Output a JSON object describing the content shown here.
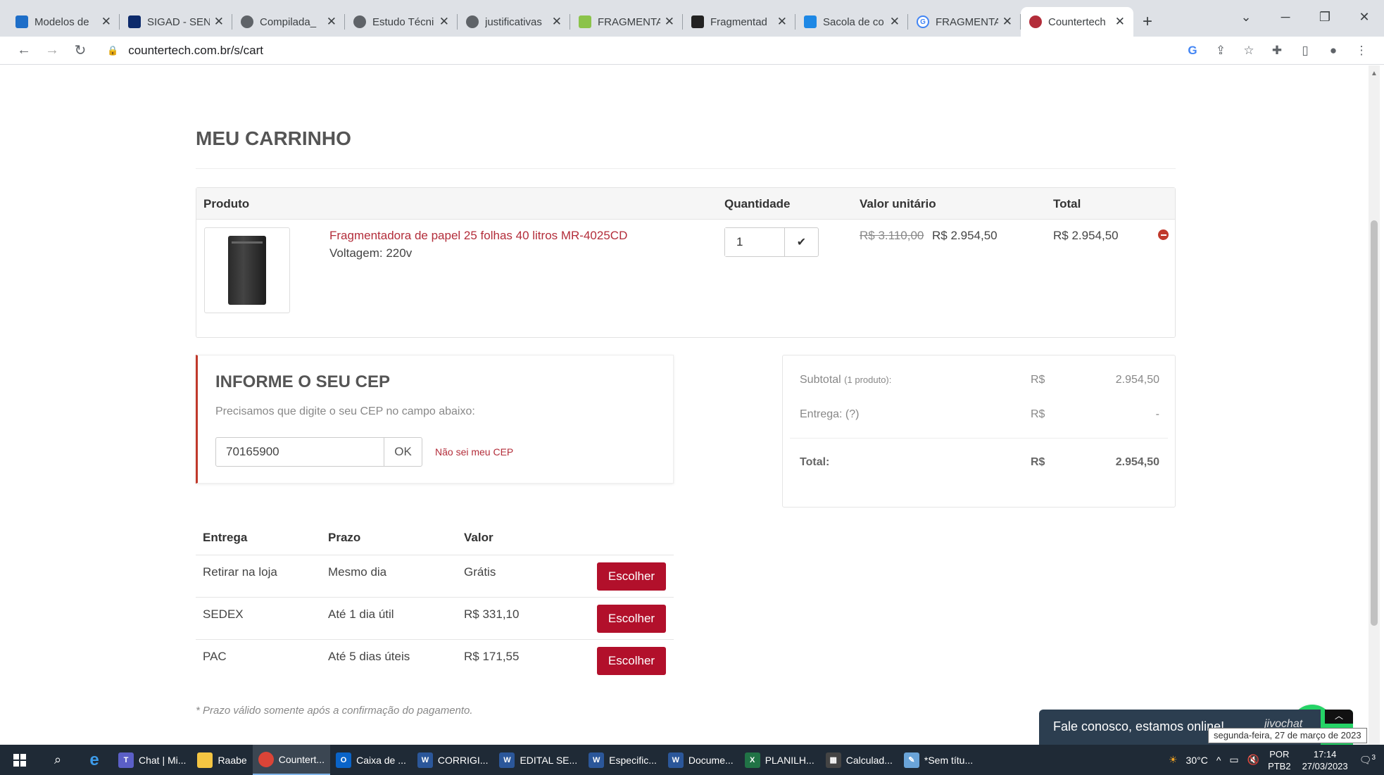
{
  "browser": {
    "tabs": [
      {
        "title": "Modelos de",
        "icon": "monitor-icon",
        "color": "#1e6ec8"
      },
      {
        "title": "SIGAD - SEN",
        "icon": "sigad-icon",
        "color": "#0d2a6b"
      },
      {
        "title": "Compilada_",
        "icon": "globe-icon",
        "color": "#5f6368"
      },
      {
        "title": "Estudo Técni",
        "icon": "globe-icon",
        "color": "#5f6368"
      },
      {
        "title": "justificativas",
        "icon": "globe-icon",
        "color": "#5f6368"
      },
      {
        "title": "FRAGMENTA",
        "icon": "green-doc-icon",
        "color": "#8bc34a"
      },
      {
        "title": "Fragmentad",
        "icon": "dark-square-icon",
        "color": "#222222"
      },
      {
        "title": "Sacola de co",
        "icon": "ml-icon",
        "color": "#1e88e5"
      },
      {
        "title": "FRAGMENTA",
        "icon": "google-icon",
        "color": "#4285f4"
      },
      {
        "title": "Countertech",
        "icon": "countertech-icon",
        "color": "#b32d3a",
        "active": true
      }
    ],
    "url": "countertech.com.br/s/cart"
  },
  "cart": {
    "title": "MEU CARRINHO",
    "headers": {
      "product": "Produto",
      "quantity": "Quantidade",
      "unit_price": "Valor unitário",
      "total": "Total"
    },
    "item": {
      "name": "Fragmentadora de papel 25 folhas 40 litros MR-4025CD",
      "voltage": "Voltagem: 220v",
      "quantity": "1",
      "old_price": "R$ 3.110,00",
      "price": "R$ 2.954,50",
      "total": "R$ 2.954,50"
    }
  },
  "cep": {
    "title": "INFORME O SEU CEP",
    "description": "Precisamos que digite o seu CEP no campo abaixo:",
    "value": "70165900",
    "ok_label": "OK",
    "help_link": "Não sei meu CEP"
  },
  "summary": {
    "subtotal_label": "Subtotal",
    "subtotal_note": "(1 produto):",
    "currency": "R$",
    "subtotal_value": "2.954,50",
    "delivery_label": "Entrega: (?)",
    "delivery_value": "-",
    "total_label": "Total:",
    "total_value": "2.954,50"
  },
  "shipping": {
    "headers": {
      "delivery": "Entrega",
      "term": "Prazo",
      "value": "Valor"
    },
    "button_label": "Escolher",
    "options": [
      {
        "delivery": "Retirar na loja",
        "term": "Mesmo dia",
        "value": "Grátis"
      },
      {
        "delivery": "SEDEX",
        "term": "Até 1 dia útil",
        "value": "R$ 331,10"
      },
      {
        "delivery": "PAC",
        "term": "Até 5 dias úteis",
        "value": "R$ 171,55"
      }
    ],
    "note": "* Prazo válido somente após a confirmação do pagamento."
  },
  "chat": {
    "message": "Fale conosco, estamos online!",
    "brand": "jivochat",
    "tooltip": "segunda-feira, 27 de março de 2023"
  },
  "taskbar": {
    "items": [
      {
        "label": "Chat | Mi...",
        "icon": "teams-icon",
        "color": "#5b5fc7"
      },
      {
        "label": "Raabe",
        "icon": "folder-icon",
        "color": "#f4c542"
      },
      {
        "label": "Countert...",
        "icon": "chrome-icon",
        "color": "#db4437",
        "active": true
      },
      {
        "label": "Caixa de ...",
        "icon": "outlook-icon",
        "color": "#0a64c8"
      },
      {
        "label": "CORRIGI...",
        "icon": "word-icon",
        "color": "#2b579a"
      },
      {
        "label": "EDITAL SE...",
        "icon": "word-icon",
        "color": "#2b579a"
      },
      {
        "label": "Especific...",
        "icon": "word-icon",
        "color": "#2b579a"
      },
      {
        "label": "Docume...",
        "icon": "word-icon",
        "color": "#2b579a"
      },
      {
        "label": "PLANILH...",
        "icon": "excel-icon",
        "color": "#217346"
      },
      {
        "label": "Calculad...",
        "icon": "calculator-icon",
        "color": "#444444"
      },
      {
        "label": "*Sem títu...",
        "icon": "notepad-icon",
        "color": "#6aa4d8"
      }
    ],
    "weather": "30°C",
    "lang_top": "POR",
    "lang_bottom": "PTB2",
    "time": "17:14",
    "date": "27/03/2023",
    "notifications": "3"
  },
  "colors": {
    "accent": "#b2102b",
    "link": "#b32d3a",
    "whatsapp": "#25d366"
  }
}
